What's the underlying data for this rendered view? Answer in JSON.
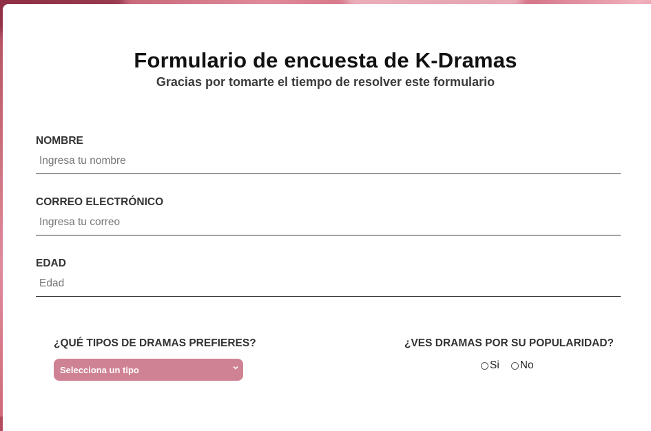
{
  "header": {
    "title": "Formulario de encuesta de K-Dramas",
    "subtitle": "Gracias por tomarte el tiempo de resolver este formulario"
  },
  "fields": {
    "nombre": {
      "label": "NOMBRE",
      "placeholder": "Ingresa tu nombre",
      "value": ""
    },
    "correo": {
      "label": "CORREO ELECTRÓNICO",
      "placeholder": "Ingresa tu correo",
      "value": ""
    },
    "edad": {
      "label": "EDAD",
      "placeholder": "Edad",
      "value": ""
    }
  },
  "drama_type": {
    "label": "¿QUÉ TIPOS DE DRAMAS PREFIERES?",
    "selected": "Selecciona un tipo"
  },
  "popularity": {
    "label": "¿VES DRAMAS POR SU POPULARIDAD?",
    "options": [
      "Si",
      "No"
    ]
  },
  "colors": {
    "accent": "#cf8294",
    "background": "#c85c72"
  },
  "icons": {
    "select_arrow": "chevron-down-icon"
  }
}
